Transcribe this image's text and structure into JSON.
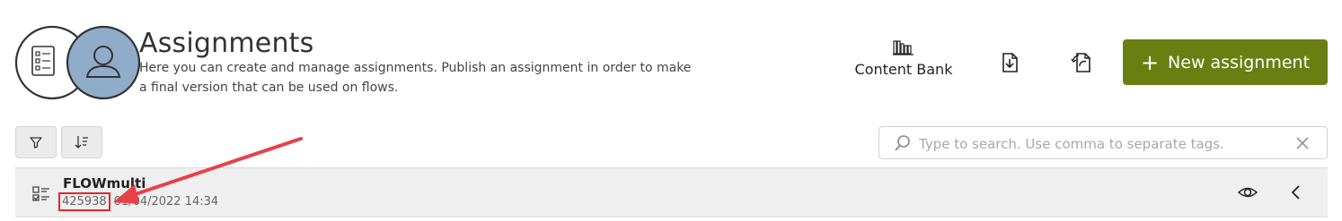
{
  "header": {
    "title": "Assignments",
    "subtitle": "Here you can create and manage assignments. Publish an assignment in order to make a final version that can be used on flows.",
    "logo_icons": [
      "checklist-document-icon",
      "user-avatar-icon"
    ]
  },
  "actions": {
    "content_bank_label": "Content Bank",
    "content_bank_icon": "books-icon",
    "import_icon": "document-import-icon",
    "export_icon": "document-refresh-icon",
    "new_assignment_label": "New assignment",
    "new_assignment_icon": "plus-icon",
    "accent_color": "#6a7f12"
  },
  "toolbar": {
    "filter_icon": "filter-icon",
    "sort_icon": "sort-icon",
    "search_placeholder": "Type to search. Use comma to separate tags.",
    "search_value": "",
    "search_icon": "search-icon",
    "clear_icon": "close-icon"
  },
  "list": {
    "items": [
      {
        "name": "FLOWmulti",
        "id": "425938",
        "date": "01/04/2022 14:34",
        "icon": "checklist-icon",
        "view_icon": "eye-icon",
        "expand_icon": "chevron-left-icon"
      }
    ]
  },
  "annotation": {
    "highlight_color": "#e8232c"
  }
}
